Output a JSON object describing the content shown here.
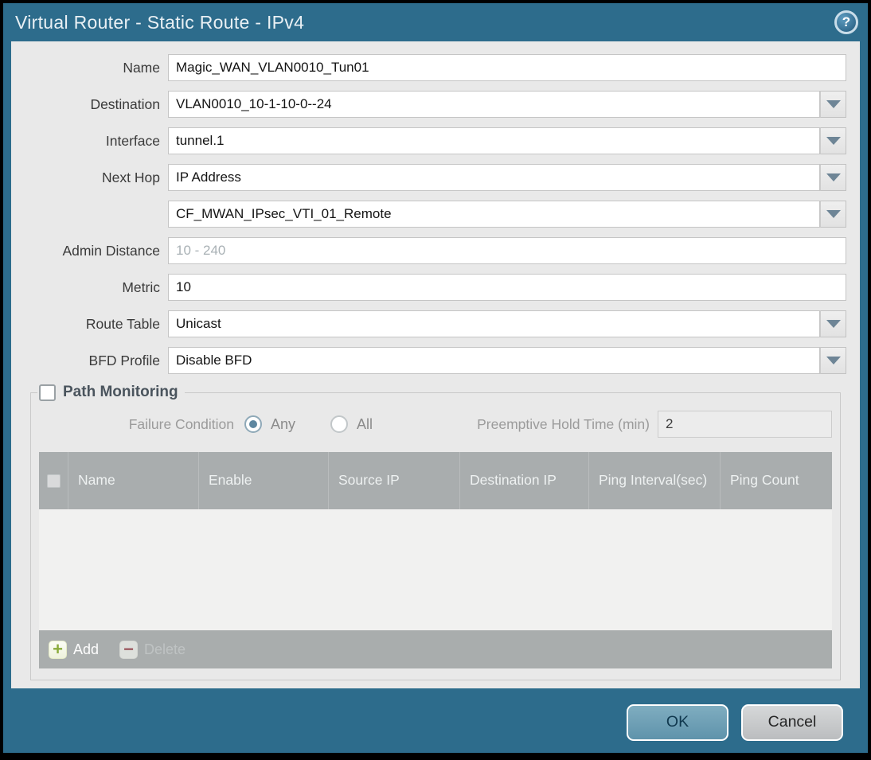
{
  "dialog": {
    "title": "Virtual Router - Static Route - IPv4",
    "help_icon": "?"
  },
  "form": {
    "name": {
      "label": "Name",
      "value": "Magic_WAN_VLAN0010_Tun01"
    },
    "destination": {
      "label": "Destination",
      "value": "VLAN0010_10-1-10-0--24"
    },
    "interface": {
      "label": "Interface",
      "value": "tunnel.1"
    },
    "next_hop": {
      "label": "Next Hop",
      "value": "IP Address"
    },
    "next_hop_address": {
      "value": "CF_MWAN_IPsec_VTI_01_Remote"
    },
    "admin_distance": {
      "label": "Admin Distance",
      "placeholder": "10 - 240",
      "value": ""
    },
    "metric": {
      "label": "Metric",
      "value": "10"
    },
    "route_table": {
      "label": "Route Table",
      "value": "Unicast"
    },
    "bfd_profile": {
      "label": "BFD Profile",
      "value": "Disable BFD"
    }
  },
  "path_monitoring": {
    "title": "Path Monitoring",
    "failure_condition_label": "Failure Condition",
    "options": [
      {
        "label": "Any",
        "selected": true
      },
      {
        "label": "All",
        "selected": false
      }
    ],
    "preemptive_hold_label": "Preemptive Hold Time (min)",
    "preemptive_hold_value": "2",
    "table": {
      "columns": [
        "Name",
        "Enable",
        "Source IP",
        "Destination IP",
        "Ping Interval(sec)",
        "Ping Count"
      ],
      "rows": []
    },
    "add_label": "Add",
    "delete_label": "Delete"
  },
  "footer": {
    "ok_label": "OK",
    "cancel_label": "Cancel"
  },
  "colors": {
    "titlebar": "#2d6c8c",
    "content_bg": "#e9e9e9",
    "table_header": "#a9adae",
    "ok_button": "#6fa2b9",
    "add_plus_green": "#8aab3b",
    "delete_minus_red": "#9c4e55",
    "radio_dot": "#5e87a0"
  }
}
